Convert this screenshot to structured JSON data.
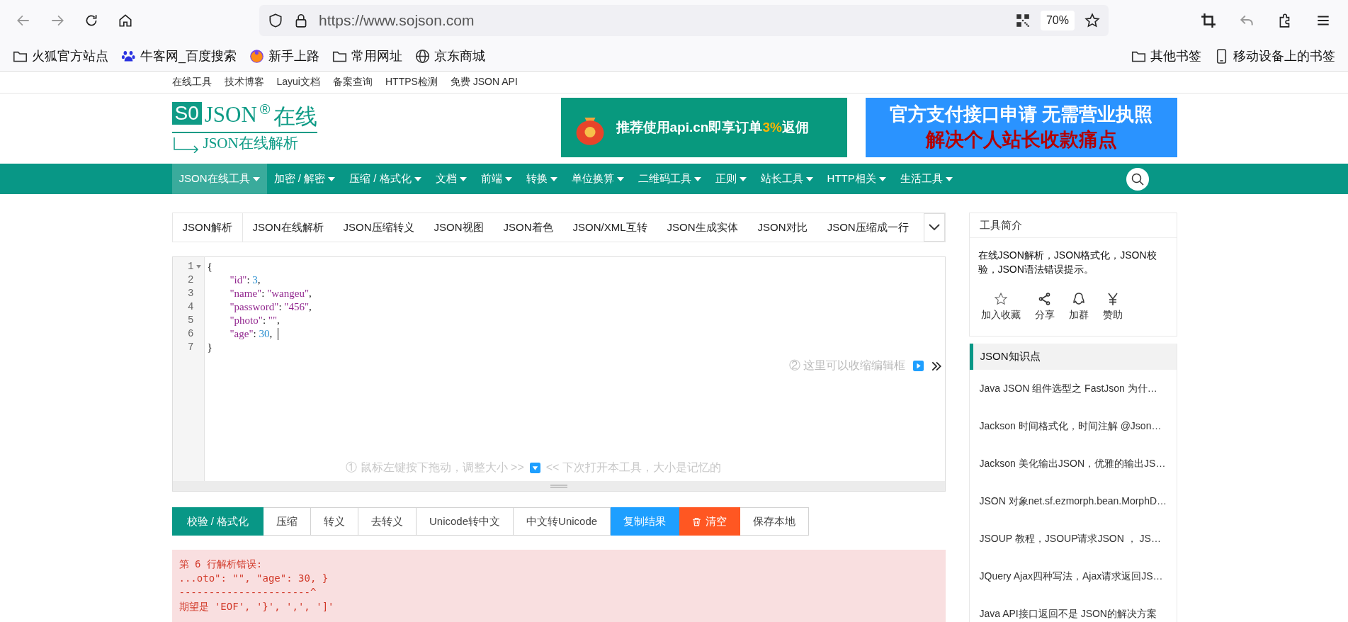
{
  "browser": {
    "url": "https://www.sojson.com",
    "zoom": "70%",
    "bookmarks": [
      {
        "label": "火狐官方站点",
        "kind": "folder"
      },
      {
        "label": "牛客网_百度搜索",
        "kind": "paw"
      },
      {
        "label": "新手上路",
        "kind": "firefox"
      },
      {
        "label": "常用网址",
        "kind": "folder"
      },
      {
        "label": "京东商城",
        "kind": "globe"
      }
    ],
    "bookmarks_right": [
      {
        "label": "其他书签",
        "kind": "folder"
      },
      {
        "label": "移动设备上的书签",
        "kind": "phone"
      }
    ]
  },
  "top_links": [
    "在线工具",
    "技术博客",
    "Layui文档",
    "备案查询",
    "HTTPS检测",
    "免费 JSON API"
  ],
  "logo": {
    "mark": "S0",
    "title": "JSON",
    "reg": "®",
    "suffix": "在线",
    "subtitle": "JSON在线解析"
  },
  "ads": [
    {
      "kind": "promo",
      "before": "推荐使用api.cn即享订单",
      "highlight": "3%",
      "after": "返佣"
    },
    {
      "kind": "banner",
      "line1": "官方支付接口申请 无需营业执照",
      "line2": "解决个人站长收款痛点"
    }
  ],
  "nav": [
    {
      "label": "JSON在线工具",
      "selected": true
    },
    {
      "label": "加密 / 解密",
      "selected": false
    },
    {
      "label": "压缩 / 格式化",
      "selected": false
    },
    {
      "label": "文档",
      "selected": false
    },
    {
      "label": "前端",
      "selected": false
    },
    {
      "label": "转换",
      "selected": false
    },
    {
      "label": "单位换算",
      "selected": false
    },
    {
      "label": "二维码工具",
      "selected": false
    },
    {
      "label": "正则",
      "selected": false
    },
    {
      "label": "站长工具",
      "selected": false
    },
    {
      "label": "HTTP相关",
      "selected": false
    },
    {
      "label": "生活工具",
      "selected": false
    }
  ],
  "tabs": [
    {
      "label": "JSON解析",
      "selected": true
    },
    {
      "label": "JSON在线解析",
      "selected": false
    },
    {
      "label": "JSON压缩转义",
      "selected": false
    },
    {
      "label": "JSON视图",
      "selected": false
    },
    {
      "label": "JSON着色",
      "selected": false
    },
    {
      "label": "JSON/XML互转",
      "selected": false
    },
    {
      "label": "JSON生成实体",
      "selected": false
    },
    {
      "label": "JSON对比",
      "selected": false
    },
    {
      "label": "JSON压缩成一行",
      "selected": false
    }
  ],
  "editor": {
    "lines": [
      {
        "number": "1",
        "indent": false,
        "foldable": true,
        "cursor": false,
        "tokens": [
          {
            "kind": "punct",
            "text": "{"
          }
        ]
      },
      {
        "number": "2",
        "indent": true,
        "foldable": false,
        "cursor": false,
        "tokens": [
          {
            "kind": "key",
            "text": "\"id\""
          },
          {
            "kind": "punct",
            "text": ": "
          },
          {
            "kind": "number",
            "text": "3"
          },
          {
            "kind": "punct",
            "text": ","
          }
        ]
      },
      {
        "number": "3",
        "indent": true,
        "foldable": false,
        "cursor": false,
        "tokens": [
          {
            "kind": "key",
            "text": "\"name\""
          },
          {
            "kind": "punct",
            "text": ": "
          },
          {
            "kind": "string",
            "text": "\"wangeu\""
          },
          {
            "kind": "punct",
            "text": ","
          }
        ]
      },
      {
        "number": "4",
        "indent": true,
        "foldable": false,
        "cursor": false,
        "tokens": [
          {
            "kind": "key",
            "text": "\"password\""
          },
          {
            "kind": "punct",
            "text": ": "
          },
          {
            "kind": "string",
            "text": "\"456\""
          },
          {
            "kind": "punct",
            "text": ","
          }
        ]
      },
      {
        "number": "5",
        "indent": true,
        "foldable": false,
        "cursor": false,
        "tokens": [
          {
            "kind": "key",
            "text": "\"photo\""
          },
          {
            "kind": "punct",
            "text": ": "
          },
          {
            "kind": "string",
            "text": "\"\""
          },
          {
            "kind": "punct",
            "text": ","
          }
        ]
      },
      {
        "number": "6",
        "indent": true,
        "foldable": false,
        "cursor": true,
        "tokens": [
          {
            "kind": "key",
            "text": "\"age\""
          },
          {
            "kind": "punct",
            "text": ": "
          },
          {
            "kind": "number",
            "text": "30"
          },
          {
            "kind": "punct",
            "text": ","
          }
        ]
      },
      {
        "number": "7",
        "indent": false,
        "foldable": false,
        "cursor": false,
        "tokens": [
          {
            "kind": "punct",
            "text": "}"
          }
        ]
      }
    ],
    "hint_right": "② 这里可以收缩编辑框",
    "hint_bottom_before": "① 鼠标左键按下拖动，调整大小 >>",
    "hint_bottom_after": "<< 下次打开本工具，大小是记忆的"
  },
  "buttons": [
    {
      "label": "校验 / 格式化",
      "kind": "primary"
    },
    {
      "label": "压缩",
      "kind": "default"
    },
    {
      "label": "转义",
      "kind": "default"
    },
    {
      "label": "去转义",
      "kind": "default"
    },
    {
      "label": "Unicode转中文",
      "kind": "default"
    },
    {
      "label": "中文转Unicode",
      "kind": "default"
    },
    {
      "label": "复制结果",
      "kind": "info"
    },
    {
      "label": "清空",
      "kind": "danger"
    },
    {
      "label": "保存本地",
      "kind": "default"
    }
  ],
  "error": [
    "第 6 行解析错误:",
    "...oto\": \"\", \"age\": 30, }",
    "----------------------^",
    "期望是 'EOF', '}', ',', ']'"
  ],
  "sidebar": {
    "intro_title": "工具简介",
    "intro_text": "在线JSON解析，JSON格式化，JSON校验，JSON语法错误提示。",
    "actions": [
      {
        "label": "加入收藏",
        "kind": "star"
      },
      {
        "label": "分享",
        "kind": "share"
      },
      {
        "label": "加群",
        "kind": "penguin"
      },
      {
        "label": "赞助",
        "kind": "yen"
      }
    ],
    "knowledge_title": "JSON知识点",
    "articles": [
      "Java JSON 组件选型之 FastJson 为什…",
      "Jackson 时间格式化，时间注解 @Json…",
      "Jackson 美化输出JSON，优雅的输出JS…",
      "JSON 对象net.sf.ezmorph.bean.MorphD…",
      "JSOUP 教程，JSOUP请求JSON ， JS…",
      "JQuery Ajax四种写法，Ajax请求返回JS…",
      "Java API接口返回不是 JSON的解决方案"
    ]
  }
}
